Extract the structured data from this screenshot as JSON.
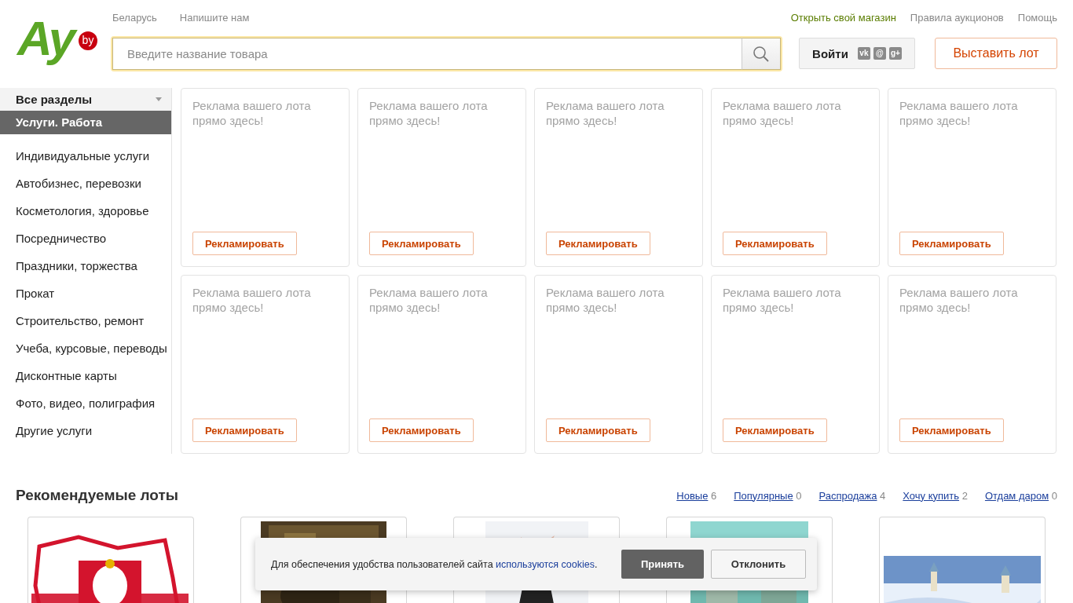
{
  "logo": {
    "main": "Ay",
    "badge": "by"
  },
  "top_links_left": [
    "Беларусь",
    "Напишите нам"
  ],
  "top_links_right": [
    {
      "label": "Открыть свой магазин",
      "kind": "accent"
    },
    {
      "label": "Правила аукционов",
      "kind": "plain"
    },
    {
      "label": "Помощь",
      "kind": "plain"
    }
  ],
  "search": {
    "placeholder": "Введите название товара"
  },
  "login": {
    "label": "Войти",
    "social": [
      "vk",
      "@",
      "g+"
    ]
  },
  "post_lot_button": "Выставить лот",
  "sidebar": {
    "all_sections": "Все разделы",
    "current_section": "Услуги. Работа",
    "items": [
      "Индивидуальные услуги",
      "Автобизнес, перевозки",
      "Косметология, здоровье",
      "Посредничество",
      "Праздники, торжества",
      "Прокат",
      "Строительство, ремонт",
      "Учеба, курсовые, переводы",
      "Дисконтные карты",
      "Фото, видео, полиграфия",
      "Другие услуги"
    ]
  },
  "ads": [
    {
      "text": "Реклама вашего лота прямо здесь!",
      "button": "Рекламировать"
    },
    {
      "text": "Реклама вашего лота прямо здесь!",
      "button": "Рекламировать"
    },
    {
      "text": "Реклама вашего лота прямо здесь!",
      "button": "Рекламировать"
    },
    {
      "text": "Реклама вашего лота прямо здесь!",
      "button": "Рекламировать"
    },
    {
      "text": "Реклама вашего лота прямо здесь!",
      "button": "Рекламировать"
    },
    {
      "text": "Реклама вашего лота прямо здесь!",
      "button": "Рекламировать"
    },
    {
      "text": "Реклама вашего лота прямо здесь!",
      "button": "Рекламировать"
    },
    {
      "text": "Реклама вашего лота прямо здесь!",
      "button": "Рекламировать"
    },
    {
      "text": "Реклама вашего лота прямо здесь!",
      "button": "Рекламировать"
    },
    {
      "text": "Реклама вашего лота прямо здесь!",
      "button": "Рекламировать"
    }
  ],
  "recommended": {
    "title": "Рекомендуемые лоты",
    "filters": [
      {
        "label": "Новые",
        "count": "6"
      },
      {
        "label": "Популярные",
        "count": "0"
      },
      {
        "label": "Распродажа",
        "count": "4"
      },
      {
        "label": "Хочу купить",
        "count": "2"
      },
      {
        "label": "Отдам даром",
        "count": "0"
      }
    ]
  },
  "cookie_banner": {
    "text": "Для обеспечения удобства пользователей сайта ",
    "link": "используются cookies",
    "after": ".",
    "accept": "Принять",
    "decline": "Отклонить"
  }
}
